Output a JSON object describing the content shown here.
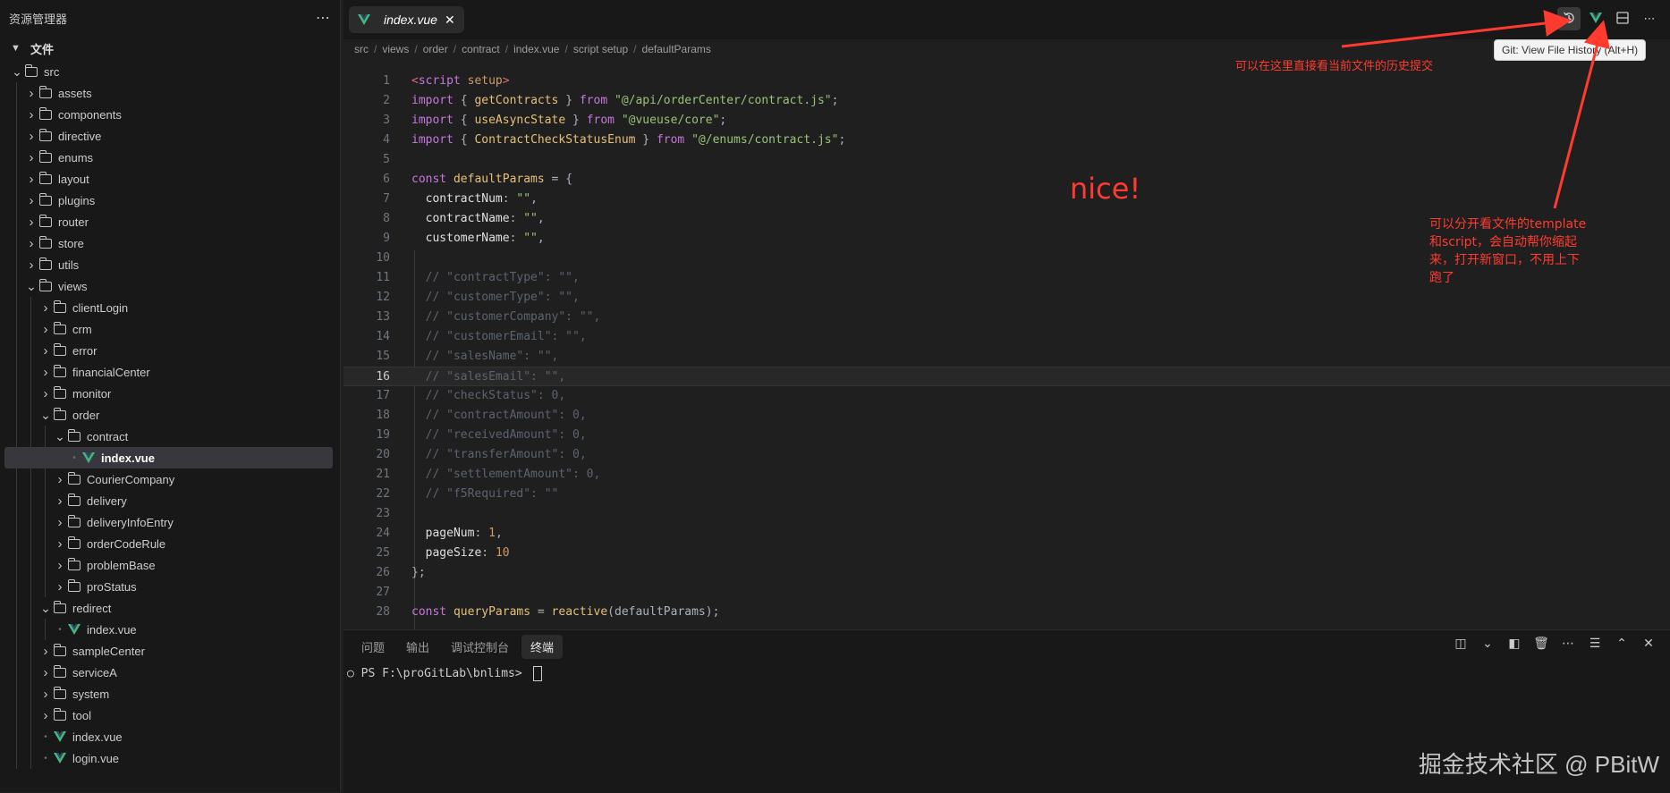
{
  "explorer": {
    "title": "资源管理器",
    "more_icon": "ellipsis-icon",
    "section": "文件",
    "tree": [
      {
        "label": "src",
        "type": "folder",
        "depth": 0,
        "expanded": true
      },
      {
        "label": "assets",
        "type": "folder",
        "depth": 1,
        "expanded": false
      },
      {
        "label": "components",
        "type": "folder",
        "depth": 1,
        "expanded": false
      },
      {
        "label": "directive",
        "type": "folder",
        "depth": 1,
        "expanded": false
      },
      {
        "label": "enums",
        "type": "folder",
        "depth": 1,
        "expanded": false
      },
      {
        "label": "layout",
        "type": "folder",
        "depth": 1,
        "expanded": false
      },
      {
        "label": "plugins",
        "type": "folder",
        "depth": 1,
        "expanded": false
      },
      {
        "label": "router",
        "type": "folder",
        "depth": 1,
        "expanded": false
      },
      {
        "label": "store",
        "type": "folder",
        "depth": 1,
        "expanded": false
      },
      {
        "label": "utils",
        "type": "folder",
        "depth": 1,
        "expanded": false
      },
      {
        "label": "views",
        "type": "folder",
        "depth": 1,
        "expanded": true
      },
      {
        "label": "clientLogin",
        "type": "folder",
        "depth": 2,
        "expanded": false
      },
      {
        "label": "crm",
        "type": "folder",
        "depth": 2,
        "expanded": false
      },
      {
        "label": "error",
        "type": "folder",
        "depth": 2,
        "expanded": false
      },
      {
        "label": "financialCenter",
        "type": "folder",
        "depth": 2,
        "expanded": false
      },
      {
        "label": "monitor",
        "type": "folder",
        "depth": 2,
        "expanded": false
      },
      {
        "label": "order",
        "type": "folder",
        "depth": 2,
        "expanded": true
      },
      {
        "label": "contract",
        "type": "folder",
        "depth": 3,
        "expanded": true
      },
      {
        "label": "index.vue",
        "type": "vue",
        "depth": 4,
        "selected": true
      },
      {
        "label": "CourierCompany",
        "type": "folder",
        "depth": 3,
        "expanded": false
      },
      {
        "label": "delivery",
        "type": "folder",
        "depth": 3,
        "expanded": false
      },
      {
        "label": "deliveryInfoEntry",
        "type": "folder",
        "depth": 3,
        "expanded": false
      },
      {
        "label": "orderCodeRule",
        "type": "folder",
        "depth": 3,
        "expanded": false
      },
      {
        "label": "problemBase",
        "type": "folder",
        "depth": 3,
        "expanded": false
      },
      {
        "label": "proStatus",
        "type": "folder",
        "depth": 3,
        "expanded": false
      },
      {
        "label": "redirect",
        "type": "folder",
        "depth": 2,
        "expanded": true
      },
      {
        "label": "index.vue",
        "type": "vue",
        "depth": 3
      },
      {
        "label": "sampleCenter",
        "type": "folder",
        "depth": 2,
        "expanded": false
      },
      {
        "label": "serviceA",
        "type": "folder",
        "depth": 2,
        "expanded": false
      },
      {
        "label": "system",
        "type": "folder",
        "depth": 2,
        "expanded": false
      },
      {
        "label": "tool",
        "type": "folder",
        "depth": 2,
        "expanded": false
      },
      {
        "label": "index.vue",
        "type": "vue",
        "depth": 2
      },
      {
        "label": "login.vue",
        "type": "vue",
        "depth": 2
      }
    ]
  },
  "editor": {
    "tab": {
      "label": "index.vue",
      "icon": "vue-icon",
      "close_icon": "close-icon"
    },
    "toolbar": [
      {
        "name": "git-history-button",
        "icon": "history-icon",
        "active": true
      },
      {
        "name": "split-vue-button",
        "icon": "vue-split-icon"
      },
      {
        "name": "split-editor-button",
        "icon": "split-editor-icon"
      },
      {
        "name": "more-actions-button",
        "icon": "ellipsis-icon"
      }
    ],
    "breadcrumb": [
      "src",
      "views",
      "order",
      "contract",
      "index.vue",
      "script setup",
      "defaultParams"
    ],
    "current_line": 16,
    "lines": [
      [
        [
          "tag",
          "<"
        ],
        [
          "kw",
          "script"
        ],
        [
          "plain",
          " "
        ],
        [
          "kw2",
          "setup"
        ],
        [
          "tag",
          ">"
        ]
      ],
      [
        [
          "kw",
          "import"
        ],
        [
          "plain",
          " { "
        ],
        [
          "fn",
          "getContracts"
        ],
        [
          "plain",
          " } "
        ],
        [
          "kw",
          "from"
        ],
        [
          "plain",
          " "
        ],
        [
          "str",
          "\"@/api/orderCenter/contract.js\""
        ],
        [
          "plain",
          ";"
        ]
      ],
      [
        [
          "kw",
          "import"
        ],
        [
          "plain",
          " { "
        ],
        [
          "fn",
          "useAsyncState"
        ],
        [
          "plain",
          " } "
        ],
        [
          "kw",
          "from"
        ],
        [
          "plain",
          " "
        ],
        [
          "str",
          "\"@vueuse/core\""
        ],
        [
          "plain",
          ";"
        ]
      ],
      [
        [
          "kw",
          "import"
        ],
        [
          "plain",
          " { "
        ],
        [
          "fn",
          "ContractCheckStatusEnum"
        ],
        [
          "plain",
          " } "
        ],
        [
          "kw",
          "from"
        ],
        [
          "plain",
          " "
        ],
        [
          "str",
          "\"@/enums/contract.js\""
        ],
        [
          "plain",
          ";"
        ]
      ],
      [],
      [
        [
          "kw",
          "const"
        ],
        [
          "plain",
          " "
        ],
        [
          "fn",
          "defaultParams"
        ],
        [
          "plain",
          " = {"
        ]
      ],
      [
        [
          "plain",
          "  "
        ],
        [
          "prop",
          "contractNum"
        ],
        [
          "plain",
          ": "
        ],
        [
          "str",
          "\"\""
        ],
        [
          "plain",
          ","
        ]
      ],
      [
        [
          "plain",
          "  "
        ],
        [
          "prop",
          "contractName"
        ],
        [
          "plain",
          ": "
        ],
        [
          "str",
          "\"\""
        ],
        [
          "plain",
          ","
        ]
      ],
      [
        [
          "plain",
          "  "
        ],
        [
          "prop",
          "customerName"
        ],
        [
          "plain",
          ": "
        ],
        [
          "str",
          "\"\""
        ],
        [
          "plain",
          ","
        ]
      ],
      [],
      [
        [
          "cm",
          "  // \"contractType\": \"\","
        ]
      ],
      [
        [
          "cm",
          "  // \"customerType\": \"\","
        ]
      ],
      [
        [
          "cm",
          "  // \"customerCompany\": \"\","
        ]
      ],
      [
        [
          "cm",
          "  // \"customerEmail\": \"\","
        ]
      ],
      [
        [
          "cm",
          "  // \"salesName\": \"\","
        ]
      ],
      [
        [
          "cm",
          "  // \"salesEmail\": \"\","
        ]
      ],
      [
        [
          "cm",
          "  // \"checkStatus\": 0,"
        ]
      ],
      [
        [
          "cm",
          "  // \"contractAmount\": 0,"
        ]
      ],
      [
        [
          "cm",
          "  // \"receivedAmount\": 0,"
        ]
      ],
      [
        [
          "cm",
          "  // \"transferAmount\": 0,"
        ]
      ],
      [
        [
          "cm",
          "  // \"settlementAmount\": 0,"
        ]
      ],
      [
        [
          "cm",
          "  // \"f5Required\": \"\""
        ]
      ],
      [],
      [
        [
          "plain",
          "  "
        ],
        [
          "prop",
          "pageNum"
        ],
        [
          "plain",
          ": "
        ],
        [
          "num",
          "1"
        ],
        [
          "plain",
          ","
        ]
      ],
      [
        [
          "plain",
          "  "
        ],
        [
          "prop",
          "pageSize"
        ],
        [
          "plain",
          ": "
        ],
        [
          "num",
          "10"
        ]
      ],
      [
        [
          "plain",
          "};"
        ]
      ],
      [],
      [
        [
          "kw",
          "const"
        ],
        [
          "plain",
          " "
        ],
        [
          "fn",
          "queryParams"
        ],
        [
          "plain",
          " = "
        ],
        [
          "fn",
          "reactive"
        ],
        [
          "plain",
          "(defaultParams);"
        ]
      ]
    ]
  },
  "panel": {
    "tabs": [
      "问题",
      "输出",
      "调试控制台",
      "终端"
    ],
    "active_tab": "终端",
    "actions": [
      "split-terminal-icon",
      "chevron-down-icon",
      "split-panel-icon",
      "trash-icon",
      "ellipsis-icon",
      "sliders-icon",
      "chevron-up-icon",
      "close-icon"
    ],
    "terminal_prompt": "PS F:\\proGitLab\\bnlims> "
  },
  "tooltip": "Git: View File History (Alt+H)",
  "annotations": {
    "history_note": "可以在这里直接看当前文件的历史提交",
    "nice": "nice!",
    "split_note": "可以分开看文件的template和script，会自动帮你缩起来，打开新窗口，不用上下跑了"
  },
  "watermark": "掘金技术社区 @ PBitW",
  "colors": {
    "annotation": "#ff3b30",
    "vue_green": "#41b883",
    "vue_dark": "#35495e"
  }
}
